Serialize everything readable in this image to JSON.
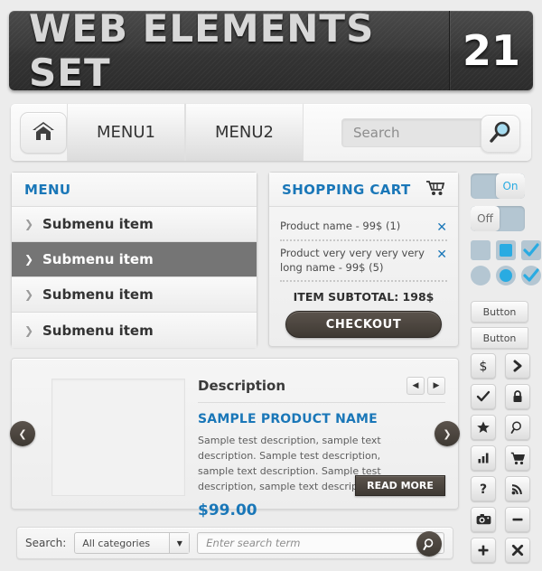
{
  "banner": {
    "title": "WEB ELEMENTS SET",
    "number": "21"
  },
  "navbar": {
    "home_icon": "home-icon",
    "tabs": [
      {
        "label": "MENU1"
      },
      {
        "label": "MENU2"
      }
    ],
    "search_placeholder": "Search",
    "search_icon": "search-icon"
  },
  "menu_panel": {
    "header": "MENU",
    "items": [
      {
        "label": "Submenu item",
        "bullet": "❯",
        "active": false
      },
      {
        "label": "Submenu item",
        "bullet": "❯",
        "active": true
      },
      {
        "label": "Submenu item",
        "bullet": "❯",
        "active": false
      },
      {
        "label": "Submenu item",
        "bullet": "❯",
        "active": false
      }
    ]
  },
  "cart_panel": {
    "header": "SHOPPING CART",
    "cart_icon": "shopping-cart-icon",
    "items": [
      {
        "name": "Product name - 99$ (1)",
        "remove": "✕"
      },
      {
        "name": "Product very very very very long name - 99$ (5)",
        "remove": "✕"
      }
    ],
    "subtotal": "ITEM SUBTOTAL: 198$",
    "checkout_label": "CHECKOUT"
  },
  "sidebar": {
    "toggle_on": {
      "label": "On",
      "state": "on"
    },
    "toggle_off": {
      "label": "Off",
      "state": "off"
    },
    "checkboxes": [
      {
        "name": "checkbox-empty",
        "state": "empty"
      },
      {
        "name": "checkbox-filled",
        "state": "filled"
      },
      {
        "name": "checkbox-checked",
        "state": "checked"
      }
    ],
    "radios": [
      {
        "name": "radio-empty",
        "state": "empty"
      },
      {
        "name": "radio-filled",
        "state": "filled"
      },
      {
        "name": "radio-checked",
        "state": "checked"
      }
    ],
    "buttons": [
      {
        "label": "Button"
      },
      {
        "label": "Button"
      }
    ],
    "icons": [
      {
        "name": "dollar-icon",
        "glyph": "$"
      },
      {
        "name": "chevron-right-icon",
        "glyph": "❯"
      },
      {
        "name": "check-icon",
        "glyph": "✔"
      },
      {
        "name": "lock-icon",
        "glyph": "🔒"
      },
      {
        "name": "star-icon",
        "glyph": "★"
      },
      {
        "name": "search-icon",
        "glyph": "⌕"
      },
      {
        "name": "bar-chart-icon",
        "glyph": "ᴵ"
      },
      {
        "name": "cart-icon",
        "glyph": "🛒"
      },
      {
        "name": "question-icon",
        "glyph": "?"
      },
      {
        "name": "rss-icon",
        "glyph": "◜"
      },
      {
        "name": "camera-icon",
        "glyph": "📷"
      },
      {
        "name": "minus-icon",
        "glyph": "–"
      },
      {
        "name": "plus-icon",
        "glyph": "+"
      },
      {
        "name": "close-icon",
        "glyph": "✕"
      }
    ]
  },
  "product": {
    "description_title": "Description",
    "prev_glyph": "◀",
    "next_glyph": "▶",
    "name": "SAMPLE PRODUCT NAME",
    "description": "Sample test description, sample text description. Sample test description, sample text description. Sample test description, sample text description.",
    "price": "$99.00",
    "read_more_label": "READ MORE",
    "carousel_prev": "❮",
    "carousel_next": "❯"
  },
  "bottom_search": {
    "label": "Search:",
    "category_value": "All categories",
    "caret": "▼",
    "input_placeholder": "Enter search term",
    "button_icon": "search-icon"
  },
  "colors": {
    "accent_blue": "#1a77b8",
    "control_blue": "#29abe2",
    "control_track": "#b4c6d2",
    "dark_button": "#3e3933",
    "active_menu": "#757575",
    "page_bg": "#ececec"
  }
}
